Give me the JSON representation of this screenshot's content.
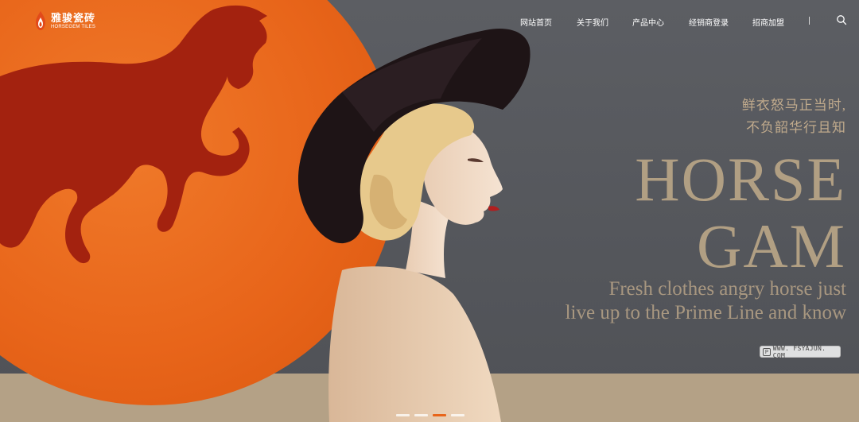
{
  "brand": {
    "name_cn": "雅骏瓷砖",
    "name_en": "HORSEGEM TILES",
    "logo_icon": "flame-logo-icon"
  },
  "nav": {
    "items": [
      {
        "label": "网站首页"
      },
      {
        "label": "关于我们"
      },
      {
        "label": "产品中心"
      },
      {
        "label": "经销商登录"
      },
      {
        "label": "招商加盟"
      }
    ],
    "search_icon": "search-icon"
  },
  "hero": {
    "slogan_cn": [
      "鲜衣怒马正当时,",
      "不负韶华行且知"
    ],
    "title": [
      "HORSE",
      "GAM"
    ],
    "subtitle_en": [
      "Fresh clothes angry horse just",
      "live up to the Prime Line and know"
    ],
    "watermark": "WWW. FSYAJUN. COM",
    "colors": {
      "sun": "#e8651a",
      "horse": "#a3220f",
      "background": "#55575c",
      "floor": "#b4a186",
      "text": "#b19f83"
    }
  },
  "carousel": {
    "slide_count": 4,
    "active_index": 2
  }
}
